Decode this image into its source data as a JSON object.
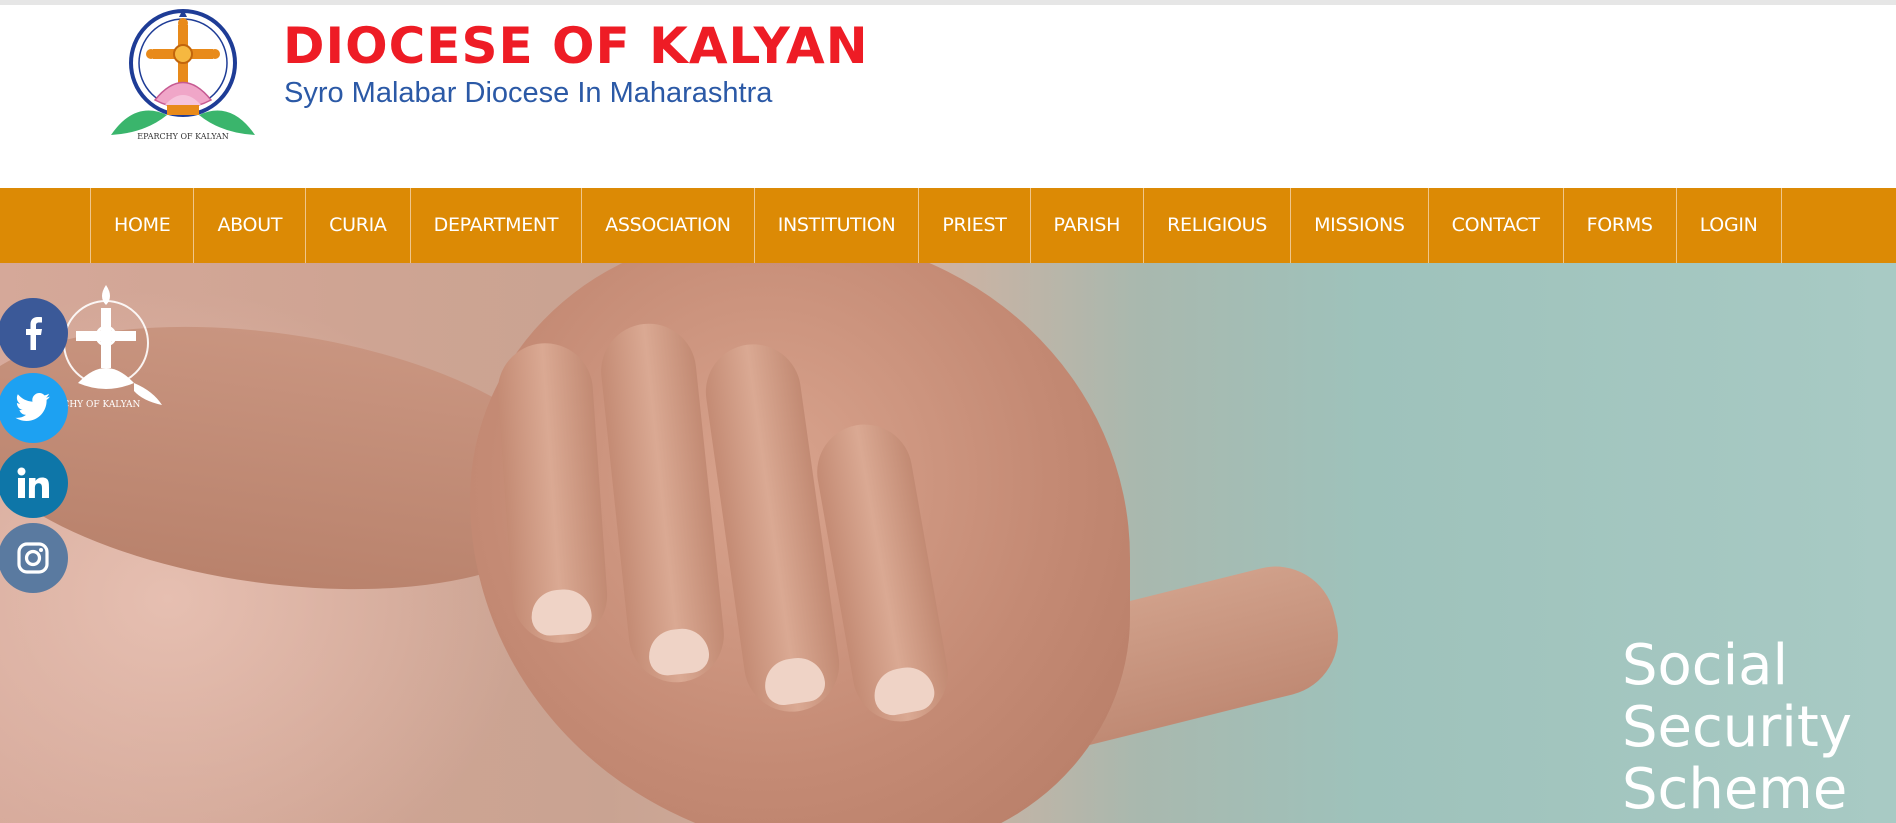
{
  "header": {
    "title": "DIOCESE OF KALYAN",
    "subtitle": "Syro Malabar Diocese In Maharashtra",
    "logo_icon": "eparchy-of-kalyan-emblem"
  },
  "nav": {
    "items": [
      {
        "label": "HOME"
      },
      {
        "label": "ABOUT"
      },
      {
        "label": "CURIA"
      },
      {
        "label": "DEPARTMENT"
      },
      {
        "label": "ASSOCIATION"
      },
      {
        "label": "INSTITUTION"
      },
      {
        "label": "PRIEST"
      },
      {
        "label": "PARISH"
      },
      {
        "label": "RELIGIOUS"
      },
      {
        "label": "MISSIONS"
      },
      {
        "label": "CONTACT"
      },
      {
        "label": "FORMS"
      },
      {
        "label": "LOGIN"
      }
    ]
  },
  "hero": {
    "caption_line1": "Social",
    "caption_line2": "Security",
    "caption_line3": "Scheme",
    "watermark_icon": "eparchy-emblem-watermark"
  },
  "social": [
    {
      "icon": "facebook-icon",
      "color": "#3b5998"
    },
    {
      "icon": "twitter-icon",
      "color": "#1da1f2"
    },
    {
      "icon": "linkedin-icon",
      "color": "#0e76a8"
    },
    {
      "icon": "instagram-icon",
      "color": "#5a7aa0"
    }
  ],
  "colors": {
    "nav_background": "#dc8a05",
    "title_red": "#ee1c25",
    "subtitle_blue": "#2b59a6"
  }
}
